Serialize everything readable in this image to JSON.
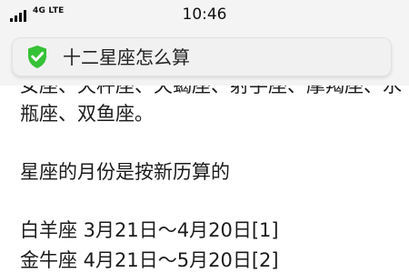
{
  "status_bar": {
    "network": "4G LTE",
    "time": "10:46"
  },
  "search": {
    "query": "十二星座怎么算"
  },
  "article": {
    "lines": [
      "女座、天秤座、天蝎座、射手座、摩羯座、水",
      "瓶座、双鱼座。",
      "星座的月份是按新历算的",
      "白羊座 3月21日～4月20日[1]",
      "金牛座 4月21日～5月20日[2]"
    ]
  },
  "colors": {
    "status_background": "#f4f4f4",
    "shield_green": "#35c236",
    "text": "#1b1b1b"
  }
}
